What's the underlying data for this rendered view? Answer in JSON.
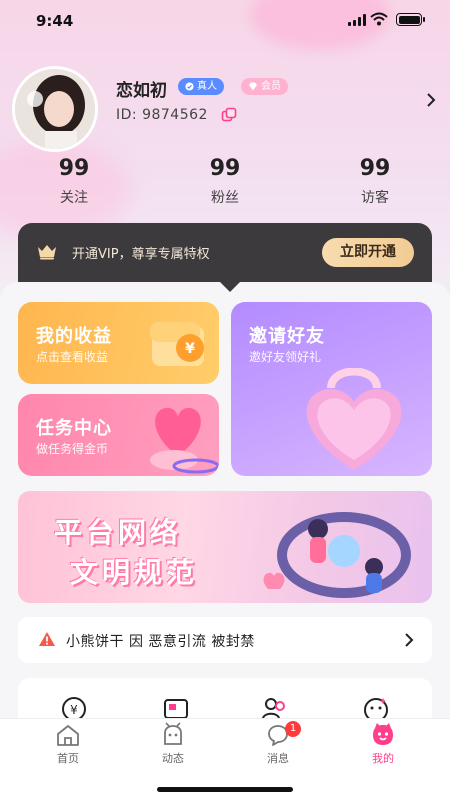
{
  "status": {
    "time": "9:44"
  },
  "profile": {
    "nickname": "恋如初",
    "badge_real": "真人",
    "badge_member": "会员",
    "id_text": "ID: 9874562"
  },
  "stats": [
    {
      "value": "99",
      "label": "关注"
    },
    {
      "value": "99",
      "label": "粉丝"
    },
    {
      "value": "99",
      "label": "访客"
    }
  ],
  "vip": {
    "text": "开通VIP，尊享专属特权",
    "button": "立即开通"
  },
  "cards": {
    "income": {
      "title": "我的收益",
      "subtitle": "点击查看收益"
    },
    "task": {
      "title": "任务中心",
      "subtitle": "做任务得金币"
    },
    "invite": {
      "title": "邀请好友",
      "subtitle": "邀好友领好礼"
    }
  },
  "banner": {
    "line1": "平台网络",
    "line2": "文明规范"
  },
  "notice": {
    "text": "小熊饼干 因 恶意引流 被封禁"
  },
  "tabbar": {
    "items": [
      {
        "label": "首页"
      },
      {
        "label": "动态"
      },
      {
        "label": "消息"
      },
      {
        "label": "我的"
      }
    ],
    "message_badge": "1"
  },
  "colors": {
    "accent": "#ff3f8c",
    "vip_bar": "#3c3a3c",
    "vip_button": "#f2cb92"
  }
}
